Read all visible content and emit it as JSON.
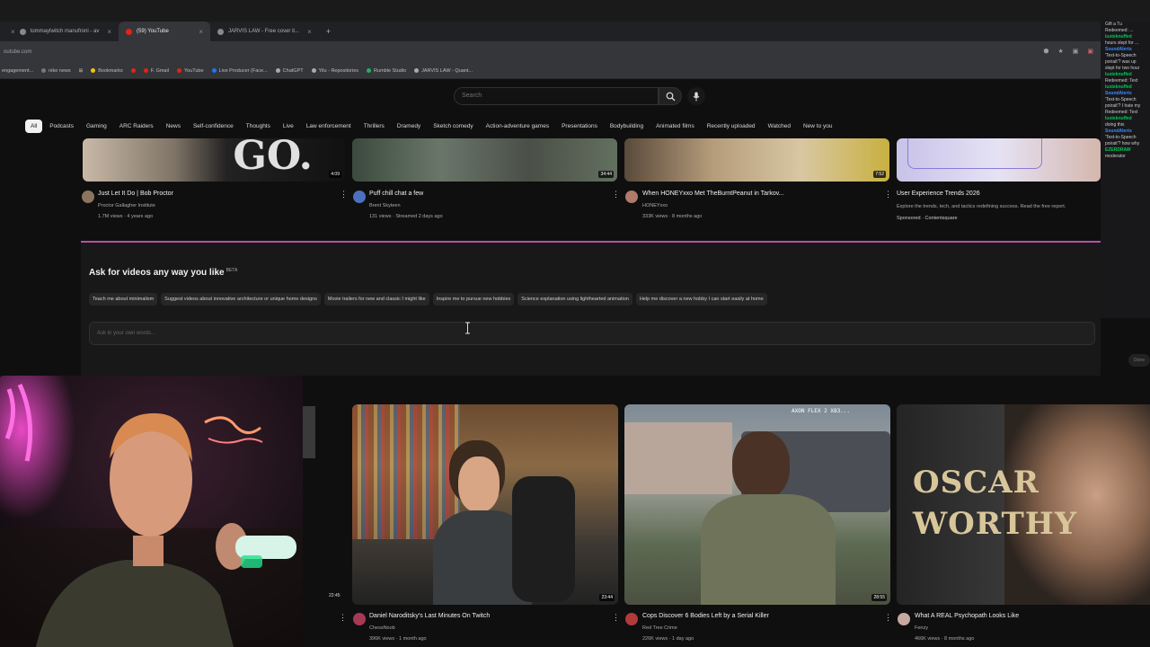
{
  "browser": {
    "tabs": [
      {
        "label": "tommaytwitch manufroni - av",
        "active": false
      },
      {
        "label": "(59) YouTube",
        "active": true
      },
      {
        "label": "JARVIS LAW - Free cover it...",
        "active": false
      }
    ],
    "new_tab": "+",
    "close": "×",
    "address": "outube.com",
    "bookmarks": [
      "engagement...",
      "nike news",
      "",
      "Bookmarks",
      "",
      "F. Gmail",
      "YouTube",
      "Live Producer (Face...",
      "ChatGPT",
      "Yilu - Repositories",
      "Rumble Studio",
      "JARVIS LAW - Quant..."
    ]
  },
  "youtube": {
    "search_placeholder": "Search",
    "chips": [
      "All",
      "Podcasts",
      "Gaming",
      "ARC Raiders",
      "News",
      "Self-confidence",
      "Thoughts",
      "Live",
      "Law enforcement",
      "Thrillers",
      "Dramedy",
      "Sketch comedy",
      "Action-adventure games",
      "Presentations",
      "Bodybuilding",
      "Animated films",
      "Recently uploaded",
      "Watched",
      "New to you"
    ],
    "row1": [
      {
        "title": "Just Let It Do | Bob Proctor",
        "channel": "Proctor Gallagher Institute",
        "meta": "1.7M views · 4 years ago",
        "duration": "4:09",
        "thumb_text": "GO."
      },
      {
        "title": "Puff chill chat a few",
        "channel": "Brent Skyteen",
        "meta": "131 views · Streamed 2 days ago",
        "duration": "34:44"
      },
      {
        "title": "When HONEYxxo Met TheBurntPeanut in Tarkov...",
        "channel": "HONEYxxo",
        "meta": "333K views · 8 months ago",
        "duration": "7:52"
      },
      {
        "title": "User Experience Trends 2026",
        "channel": "Explore the trends, tech, and tactics redefining success. Read the free report.",
        "meta": "Sponsored · Contentsquare"
      }
    ],
    "ask": {
      "title": "Ask for videos any way you like",
      "beta": "BETA",
      "suggestions": [
        "Teach me about minimalism",
        "Suggest videos about innovative architecture or unique home designs",
        "Movie trailers for new and classic I might like",
        "Inspire me to pursue new hobbies",
        "Science explanation using lighthearted animation",
        "Help me discover a new hobby I can start easily at home"
      ],
      "input_placeholder": "Ask in your own words...",
      "done": "Done"
    },
    "row2": [
      {
        "title": "Daniel Naroditsky's Last Minutes On Twitch",
        "channel": "ChessNoob",
        "meta": "396K views · 1 month ago",
        "duration": "23:44"
      },
      {
        "title": "Cops Discover 6 Bodies Left by a Serial Killer",
        "channel": "Red Tree Crime",
        "meta": "226K views · 1 day ago",
        "duration": "28:55",
        "thumb_text": "AXON FLEX 2 X83..."
      },
      {
        "title": "What A REAL Psychopath Looks Like",
        "channel": "Fenzy",
        "meta": "466K views · 8 months ago",
        "thumb_text": "OSCAR WORTHY"
      }
    ],
    "left_partial_duration": "22:45"
  },
  "chat": [
    {
      "name": "",
      "text": "Gift a Tu"
    },
    {
      "name": "",
      "text": "Redeemed: ..."
    },
    {
      "name": "lusteknuffed",
      "text": ""
    },
    {
      "name": "",
      "text": "hours slept for ..."
    },
    {
      "name": "SoundAlerts",
      "text": ""
    },
    {
      "name": "",
      "text": "'Text-to-Speech"
    },
    {
      "name": "",
      "text": "poirait'? was up"
    },
    {
      "name": "",
      "text": "slept for two hour"
    },
    {
      "name": "lusteknuffed",
      "text": ""
    },
    {
      "name": "",
      "text": "Redeemed: Text"
    },
    {
      "name": "lusteknuffed",
      "text": ""
    },
    {
      "name": "SoundAlerts",
      "text": ""
    },
    {
      "name": "",
      "text": "'Text-to-Speech"
    },
    {
      "name": "",
      "text": "poirait'? I hate my"
    },
    {
      "name": "",
      "text": "Redeemed: Text"
    },
    {
      "name": "lusteknuffed",
      "text": ""
    },
    {
      "name": "",
      "text": "doing this"
    },
    {
      "name": "SoundAlerts",
      "text": ""
    },
    {
      "name": "",
      "text": "'Text-to-Speech"
    },
    {
      "name": "",
      "text": "poirait'? how why"
    },
    {
      "name": "EZERDRAW",
      "text": ""
    },
    {
      "name": "",
      "text": "moderator"
    }
  ],
  "colors": {
    "youtube_red": "#e62117",
    "ask_border": "#b64fa8",
    "chat_green": "#00c853",
    "chat_blue": "#3d8bfd"
  }
}
